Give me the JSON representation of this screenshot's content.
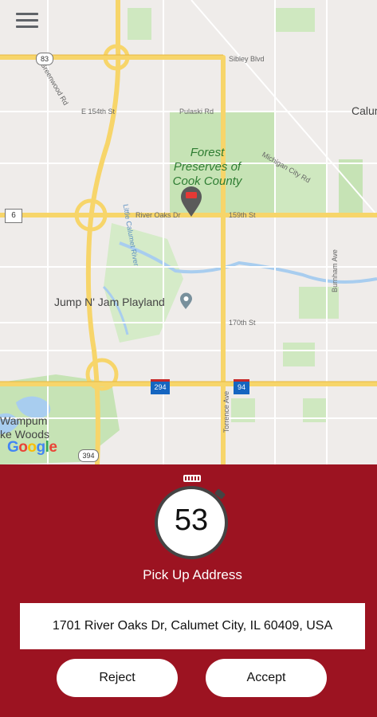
{
  "map": {
    "park_name": "Forest Preserves of Cook County",
    "poi": "Jump N' Jam Playland",
    "edge_labels": [
      "Calum",
      "Wampum",
      "ke Woods"
    ],
    "google_logo": [
      "G",
      "o",
      "o",
      "g",
      "l",
      "e"
    ],
    "roads": {
      "sibley": "Sibley Blvd",
      "pulaski": "Pulaski Rd",
      "e154": "E 154th St",
      "greenwood": "Greenwood Rd",
      "michigan": "Michigan City Rd",
      "river_oaks": "River Oaks Dr",
      "s159": "159th St",
      "s170": "170th St",
      "burnham": "Burnham Ave",
      "torrence": "Torrence Ave",
      "calumet": "Little Calumet River"
    },
    "shields": {
      "us6": "6",
      "r83": "83",
      "i294": "294",
      "i94": "94",
      "r394": "394"
    }
  },
  "timer": {
    "value": "53"
  },
  "pickup": {
    "label": "Pick Up Address",
    "address": "1701 River Oaks Dr, Calumet City, IL 60409, USA"
  },
  "actions": {
    "reject": "Reject",
    "accept": "Accept"
  },
  "colors": {
    "panel": "#9c1321",
    "highway": "#f7d56a",
    "park": "#c6e3b5",
    "water": "#a8cdef"
  }
}
